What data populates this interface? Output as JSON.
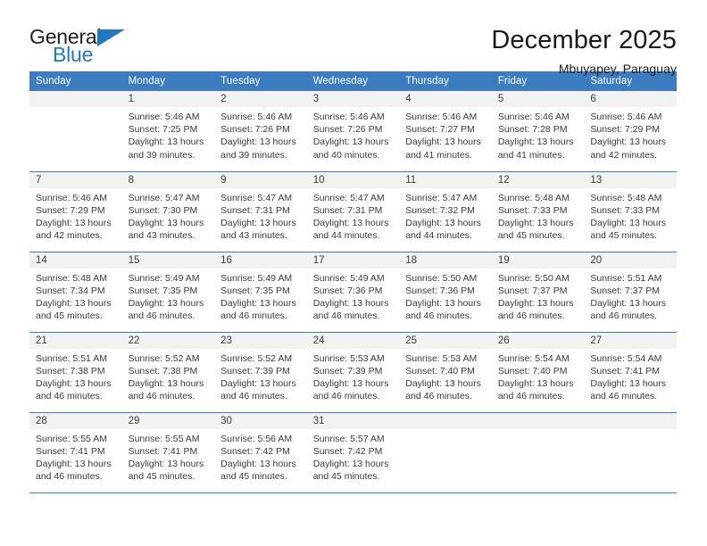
{
  "brand": {
    "name_top": "General",
    "name_bottom": "Blue",
    "triangle_color": "#1f78c1",
    "text_color": "#231f20"
  },
  "header": {
    "title": "December 2025",
    "subtitle": "Mbuyapey, Paraguay"
  },
  "theme": {
    "header_blue": "#3b7dc0",
    "daynum_band": "#f2f2f2",
    "text": "#3a3a3a"
  },
  "weekday_headers": [
    "Sunday",
    "Monday",
    "Tuesday",
    "Wednesday",
    "Thursday",
    "Friday",
    "Saturday"
  ],
  "weeks": [
    {
      "days": [
        {
          "day": "",
          "empty": true,
          "detail": ""
        },
        {
          "day": "1",
          "empty": false,
          "detail": "Sunrise: 5:46 AM\nSunset: 7:25 PM\nDaylight: 13 hours and 39 minutes."
        },
        {
          "day": "2",
          "empty": false,
          "detail": "Sunrise: 5:46 AM\nSunset: 7:26 PM\nDaylight: 13 hours and 39 minutes."
        },
        {
          "day": "3",
          "empty": false,
          "detail": "Sunrise: 5:46 AM\nSunset: 7:26 PM\nDaylight: 13 hours and 40 minutes."
        },
        {
          "day": "4",
          "empty": false,
          "detail": "Sunrise: 5:46 AM\nSunset: 7:27 PM\nDaylight: 13 hours and 41 minutes."
        },
        {
          "day": "5",
          "empty": false,
          "detail": "Sunrise: 5:46 AM\nSunset: 7:28 PM\nDaylight: 13 hours and 41 minutes."
        },
        {
          "day": "6",
          "empty": false,
          "detail": "Sunrise: 5:46 AM\nSunset: 7:29 PM\nDaylight: 13 hours and 42 minutes."
        }
      ]
    },
    {
      "days": [
        {
          "day": "7",
          "empty": false,
          "detail": "Sunrise: 5:46 AM\nSunset: 7:29 PM\nDaylight: 13 hours and 42 minutes."
        },
        {
          "day": "8",
          "empty": false,
          "detail": "Sunrise: 5:47 AM\nSunset: 7:30 PM\nDaylight: 13 hours and 43 minutes."
        },
        {
          "day": "9",
          "empty": false,
          "detail": "Sunrise: 5:47 AM\nSunset: 7:31 PM\nDaylight: 13 hours and 43 minutes."
        },
        {
          "day": "10",
          "empty": false,
          "detail": "Sunrise: 5:47 AM\nSunset: 7:31 PM\nDaylight: 13 hours and 44 minutes."
        },
        {
          "day": "11",
          "empty": false,
          "detail": "Sunrise: 5:47 AM\nSunset: 7:32 PM\nDaylight: 13 hours and 44 minutes."
        },
        {
          "day": "12",
          "empty": false,
          "detail": "Sunrise: 5:48 AM\nSunset: 7:33 PM\nDaylight: 13 hours and 45 minutes."
        },
        {
          "day": "13",
          "empty": false,
          "detail": "Sunrise: 5:48 AM\nSunset: 7:33 PM\nDaylight: 13 hours and 45 minutes."
        }
      ]
    },
    {
      "days": [
        {
          "day": "14",
          "empty": false,
          "detail": "Sunrise: 5:48 AM\nSunset: 7:34 PM\nDaylight: 13 hours and 45 minutes."
        },
        {
          "day": "15",
          "empty": false,
          "detail": "Sunrise: 5:49 AM\nSunset: 7:35 PM\nDaylight: 13 hours and 46 minutes."
        },
        {
          "day": "16",
          "empty": false,
          "detail": "Sunrise: 5:49 AM\nSunset: 7:35 PM\nDaylight: 13 hours and 46 minutes."
        },
        {
          "day": "17",
          "empty": false,
          "detail": "Sunrise: 5:49 AM\nSunset: 7:36 PM\nDaylight: 13 hours and 46 minutes."
        },
        {
          "day": "18",
          "empty": false,
          "detail": "Sunrise: 5:50 AM\nSunset: 7:36 PM\nDaylight: 13 hours and 46 minutes."
        },
        {
          "day": "19",
          "empty": false,
          "detail": "Sunrise: 5:50 AM\nSunset: 7:37 PM\nDaylight: 13 hours and 46 minutes."
        },
        {
          "day": "20",
          "empty": false,
          "detail": "Sunrise: 5:51 AM\nSunset: 7:37 PM\nDaylight: 13 hours and 46 minutes."
        }
      ]
    },
    {
      "days": [
        {
          "day": "21",
          "empty": false,
          "detail": "Sunrise: 5:51 AM\nSunset: 7:38 PM\nDaylight: 13 hours and 46 minutes."
        },
        {
          "day": "22",
          "empty": false,
          "detail": "Sunrise: 5:52 AM\nSunset: 7:38 PM\nDaylight: 13 hours and 46 minutes."
        },
        {
          "day": "23",
          "empty": false,
          "detail": "Sunrise: 5:52 AM\nSunset: 7:39 PM\nDaylight: 13 hours and 46 minutes."
        },
        {
          "day": "24",
          "empty": false,
          "detail": "Sunrise: 5:53 AM\nSunset: 7:39 PM\nDaylight: 13 hours and 46 minutes."
        },
        {
          "day": "25",
          "empty": false,
          "detail": "Sunrise: 5:53 AM\nSunset: 7:40 PM\nDaylight: 13 hours and 46 minutes."
        },
        {
          "day": "26",
          "empty": false,
          "detail": "Sunrise: 5:54 AM\nSunset: 7:40 PM\nDaylight: 13 hours and 46 minutes."
        },
        {
          "day": "27",
          "empty": false,
          "detail": "Sunrise: 5:54 AM\nSunset: 7:41 PM\nDaylight: 13 hours and 46 minutes."
        }
      ]
    },
    {
      "days": [
        {
          "day": "28",
          "empty": false,
          "detail": "Sunrise: 5:55 AM\nSunset: 7:41 PM\nDaylight: 13 hours and 46 minutes."
        },
        {
          "day": "29",
          "empty": false,
          "detail": "Sunrise: 5:55 AM\nSunset: 7:41 PM\nDaylight: 13 hours and 45 minutes."
        },
        {
          "day": "30",
          "empty": false,
          "detail": "Sunrise: 5:56 AM\nSunset: 7:42 PM\nDaylight: 13 hours and 45 minutes."
        },
        {
          "day": "31",
          "empty": false,
          "detail": "Sunrise: 5:57 AM\nSunset: 7:42 PM\nDaylight: 13 hours and 45 minutes."
        },
        {
          "day": "",
          "empty": true,
          "detail": ""
        },
        {
          "day": "",
          "empty": true,
          "detail": ""
        },
        {
          "day": "",
          "empty": true,
          "detail": ""
        }
      ]
    }
  ]
}
